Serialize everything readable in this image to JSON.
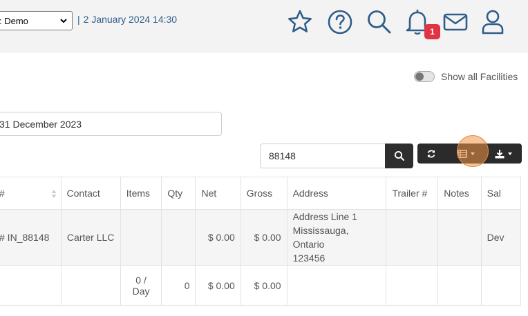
{
  "header": {
    "facility": "Demo",
    "facility_visible": ": Demo",
    "separator": "|",
    "datetime": "2 January 2024 14:30",
    "notification_count": "1",
    "icons": [
      "star-icon",
      "help-icon",
      "search-icon",
      "bell-icon",
      "mail-icon",
      "user-icon"
    ]
  },
  "filters": {
    "show_all_facilities_label": "Show all Facilities",
    "show_all_facilities_on": false,
    "date": "31 December 2023"
  },
  "search": {
    "value": "88148"
  },
  "table": {
    "columns": [
      "#",
      "Contact",
      "Items",
      "Qty",
      "Net",
      "Gross",
      "Address",
      "Trailer #",
      "Notes",
      "Sal"
    ],
    "rows": [
      {
        "number": "# IN_88148",
        "contact": "Carter LLC",
        "items": "",
        "qty": "",
        "net": "$ 0.00",
        "gross": "$ 0.00",
        "address_line1": "Address Line 1",
        "address_line2": "Mississauga, Ontario",
        "address_line3": "123456",
        "trailer": "",
        "notes": "",
        "sales": "Dev"
      }
    ],
    "totals": {
      "items_line1": "0 /",
      "items_line2": "Day",
      "qty": "0",
      "net": "$ 0.00",
      "gross": "$ 0.00"
    }
  },
  "colors": {
    "accent": "#2f5d8a",
    "badge": "#e03444",
    "toolbar": "#2b2b2b",
    "highlight": "#f0a050"
  }
}
